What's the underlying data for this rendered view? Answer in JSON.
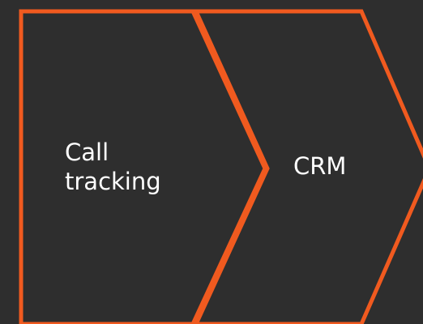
{
  "diagram": {
    "type": "chevron-process",
    "steps": [
      {
        "label": "Call\ntracking"
      },
      {
        "label": "CRM"
      }
    ],
    "colors": {
      "background": "#2e2e2e",
      "stroke": "#f05a1f",
      "text": "#ffffff"
    }
  }
}
